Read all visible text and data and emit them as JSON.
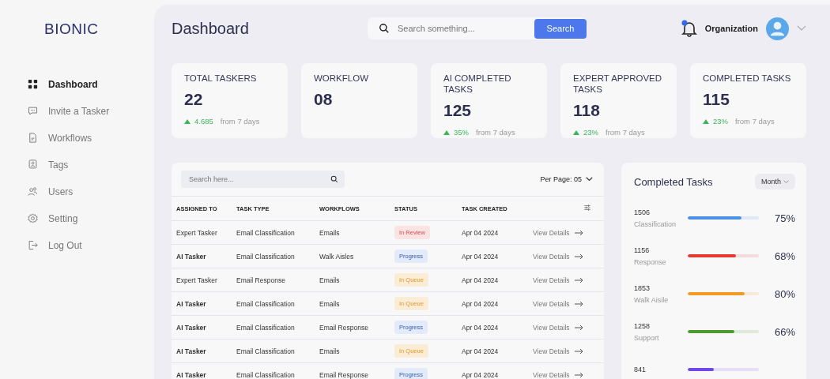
{
  "brand": "BIONIC",
  "sidebar": {
    "items": [
      {
        "label": "Dashboard",
        "selected": true
      },
      {
        "label": "Invite a Tasker",
        "selected": false
      },
      {
        "label": "Workflows",
        "selected": false
      },
      {
        "label": "Tags",
        "selected": false
      },
      {
        "label": "Users",
        "selected": false
      },
      {
        "label": "Setting",
        "selected": false
      },
      {
        "label": "Log Out",
        "selected": false
      }
    ]
  },
  "header": {
    "title": "Dashboard",
    "search": {
      "placeholder": "Search something...",
      "button": "Search"
    },
    "account": "Organization"
  },
  "stats": [
    {
      "title": "TOTAL TASKERS",
      "value": "22",
      "change": "4.685",
      "period": "from 7 days"
    },
    {
      "title": "WORKFLOW",
      "value": "08"
    },
    {
      "title": "AI COMPLETED TASKS",
      "value": "125",
      "change": "35%",
      "period": "from 7 days"
    },
    {
      "title": "EXPERT APPROVED TASKS",
      "value": "118",
      "change": "23%",
      "period": "from 7 days"
    },
    {
      "title": "COMPLETED TASKS",
      "value": "115",
      "change": "23%",
      "period": "from 7 days"
    }
  ],
  "table": {
    "search": {
      "placeholder": "Search here..."
    },
    "per_page": {
      "label": "Per Page:",
      "value": "05"
    },
    "columns": [
      "ASSIGNED TO",
      "TASK TYPE",
      "WORKFLOWS",
      "STATUS",
      "TASK CREATED"
    ],
    "rows": [
      {
        "assigned_to": "Expert Tasker",
        "kind": "expert",
        "task_type": "Email Classification",
        "workflow": "Emails",
        "status": {
          "text": "In Review",
          "kind": "review"
        },
        "created": "Apr 04  2024",
        "action": "View Details"
      },
      {
        "assigned_to": "AI Tasker",
        "kind": "ai",
        "task_type": "Email Classification",
        "workflow": "Walk Aisles",
        "status": {
          "text": "Progress",
          "kind": "progress"
        },
        "created": "Apr 04  2024",
        "action": "View Details"
      },
      {
        "assigned_to": "Expert Tasker",
        "kind": "expert",
        "task_type": "Email Response",
        "workflow": "Emails",
        "status": {
          "text": "In Queue",
          "kind": "queue"
        },
        "created": "Apr 04  2024",
        "action": "View Details"
      },
      {
        "assigned_to": "AI Tasker",
        "kind": "ai",
        "task_type": "Email Classification",
        "workflow": "Emails",
        "status": {
          "text": "In Queue",
          "kind": "queue"
        },
        "created": "Apr 04  2024",
        "action": "View Details"
      },
      {
        "assigned_to": "AI Tasker",
        "kind": "ai",
        "task_type": "Email Classification",
        "workflow": "Email Response",
        "status": {
          "text": "Progress",
          "kind": "progress"
        },
        "created": "Apr 04  2024",
        "action": "View Details"
      },
      {
        "assigned_to": "AI Tasker",
        "kind": "ai",
        "task_type": "Email Classification",
        "workflow": "Emails",
        "status": {
          "text": "In Queue",
          "kind": "queue"
        },
        "created": "Apr 04  2024",
        "action": "View Details"
      },
      {
        "assigned_to": "AI Tasker",
        "kind": "ai",
        "task_type": "Email Classification",
        "workflow": "Email Response",
        "status": {
          "text": "Progress",
          "kind": "progress"
        },
        "created": "Apr 04  2024",
        "action": "View Details"
      }
    ]
  },
  "completed": {
    "title": "Completed Tasks",
    "period": "Month",
    "items": [
      {
        "count": "1506",
        "label": "Classification",
        "level": 0.75,
        "percent": "75%",
        "color": "#4a90e2"
      },
      {
        "count": "1156",
        "label": "Response",
        "level": 0.68,
        "percent": "68%",
        "color": "#e53935"
      },
      {
        "count": "1853",
        "label": "Walk Aisile",
        "level": 0.8,
        "percent": "80%",
        "color": "#f39c24"
      },
      {
        "count": "1258",
        "label": "Support",
        "level": 0.66,
        "percent": "66%",
        "color": "#4e9a2e"
      },
      {
        "count": "841",
        "level": 0.37,
        "color": "#7048e8"
      }
    ]
  }
}
